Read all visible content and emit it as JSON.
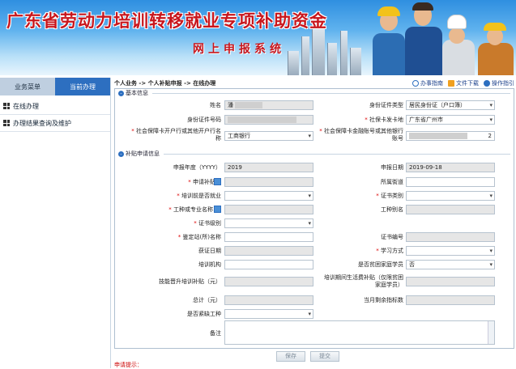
{
  "banner": {
    "title": "广东省劳动力培训转移就业专项补助资金",
    "subtitle": "网上申报系统"
  },
  "nav": {
    "tabs": [
      "业务菜单",
      "当前办理"
    ],
    "items": [
      "在线办理",
      "办理结果查询及维护"
    ]
  },
  "breadcrumb": "个人业务 -> 个人补贴申报 -> 在线办理",
  "toplinks": {
    "guide": "办事指南",
    "download": "文件下载",
    "manual": "操作指引"
  },
  "basic": {
    "section": "基本信息",
    "name_label": "姓名",
    "name_value": "潘",
    "idtype_label": "身份证件类型",
    "idtype_value": "居民身份证（户口簿）",
    "idno_label": "身份证件号码",
    "sicard_label": "社保卡发卡地",
    "sicard_value": "广东省广州市",
    "bank_label": "社会保障卡开户行或其他开户行名称",
    "bank_value": "工商银行",
    "account_label": "社会保障卡金融账号或其他银行账号",
    "account_tail": "2"
  },
  "apply": {
    "section": "补贴申请信息",
    "year_label": "申报年度（YYYY）",
    "year_value": "2019",
    "date_label": "申报日期",
    "date_value": "2019-09-18",
    "place_label": "申请补贴地",
    "street_label": "所属街道",
    "before_label": "培训前是否就业",
    "certtype_label": "证书类别",
    "job_label": "工种或专业名称",
    "jobalias_label": "工种别名",
    "certlevel_label": "证书级别",
    "station_label": "鉴定站(所)名称",
    "certno_label": "证书编号",
    "getdate_label": "获证日期",
    "studymode_label": "学习方式",
    "org_label": "培训机构",
    "poor_label": "是否贫困家庭学员",
    "poor_value": "否",
    "subsidy_label": "技能晋升培训补贴（元）",
    "living_label": "培训期间生活费补贴（仅限贫困家庭学员）",
    "total_label": "总计（元）",
    "quota_label": "当月剩余指标数",
    "shortage_label": "是否紧缺工种",
    "remark_label": "备注"
  },
  "buttons": {
    "save": "保存",
    "submit": "提交"
  },
  "tips": "申请提示："
}
